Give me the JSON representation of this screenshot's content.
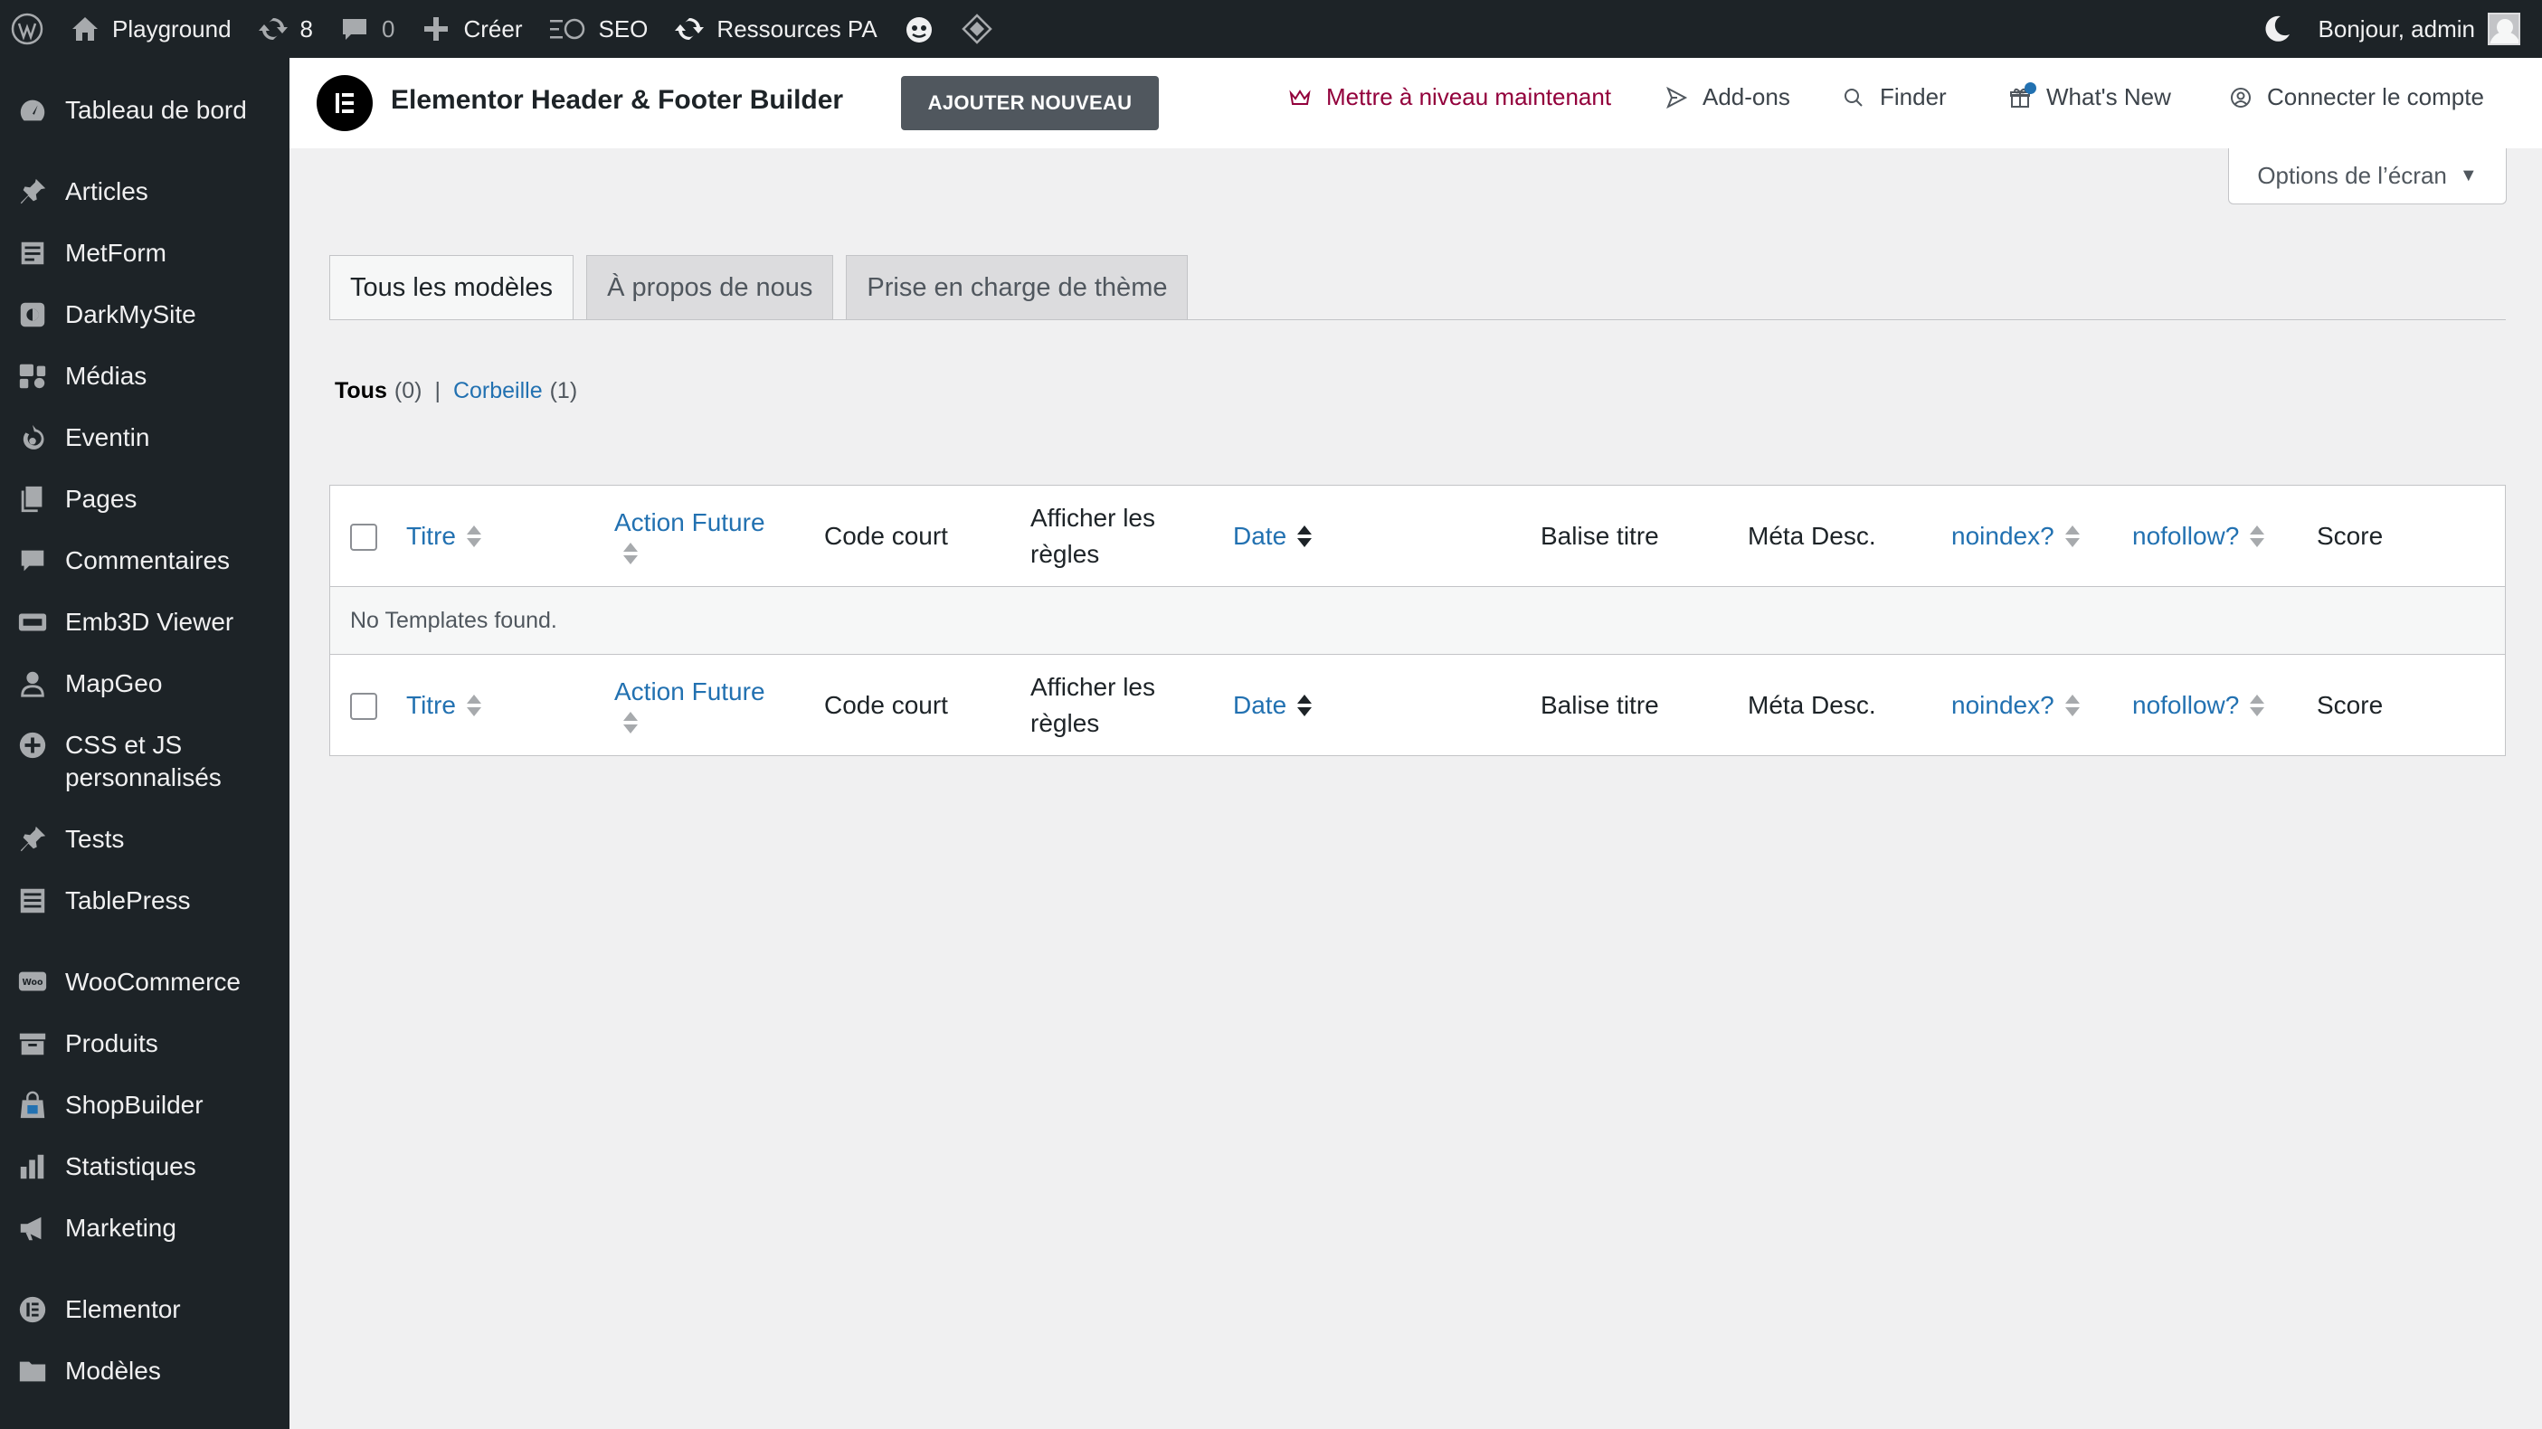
{
  "adminbar": {
    "site_name": "Playground",
    "updates_count": "8",
    "comments_count": "0",
    "new_label": "Créer",
    "seo_label": "SEO",
    "resources_label": "Ressources PA",
    "greeting": "Bonjour, admin"
  },
  "sidebar": {
    "items": [
      {
        "label": "Tableau de bord",
        "icon": "dashboard-icon"
      },
      {
        "label": "Articles",
        "icon": "pin-icon"
      },
      {
        "label": "MetForm",
        "icon": "form-icon"
      },
      {
        "label": "DarkMySite",
        "icon": "brightness-icon"
      },
      {
        "label": "Médias",
        "icon": "media-icon"
      },
      {
        "label": "Eventin",
        "icon": "eventin-icon"
      },
      {
        "label": "Pages",
        "icon": "pages-icon"
      },
      {
        "label": "Commentaires",
        "icon": "comment-icon"
      },
      {
        "label": "Emb3D Viewer",
        "icon": "emb3d-icon"
      },
      {
        "label": "MapGeo",
        "icon": "location-icon"
      },
      {
        "label": "CSS et JS personnalisés",
        "icon": "plus-circle-icon"
      },
      {
        "label": "Tests",
        "icon": "pin-icon"
      },
      {
        "label": "TablePress",
        "icon": "table-icon"
      },
      {
        "label": "WooCommerce",
        "icon": "woo-icon"
      },
      {
        "label": "Produits",
        "icon": "archive-icon"
      },
      {
        "label": "ShopBuilder",
        "icon": "bag-icon"
      },
      {
        "label": "Statistiques",
        "icon": "chart-bar-icon"
      },
      {
        "label": "Marketing",
        "icon": "megaphone-icon"
      },
      {
        "label": "Elementor",
        "icon": "elementor-icon"
      },
      {
        "label": "Modèles",
        "icon": "folder-icon"
      }
    ]
  },
  "header": {
    "plugin_title": "Elementor Header & Footer Builder",
    "add_new": "AJOUTER NOUVEAU",
    "upgrade": "Mettre à niveau maintenant",
    "addons": "Add-ons",
    "finder": "Finder",
    "whats_new": "What's New",
    "connect": "Connecter le compte"
  },
  "screen_options": "Options de l’écran",
  "tabs": [
    {
      "label": "Tous les modèles",
      "active": true
    },
    {
      "label": "À propos de nous",
      "active": false
    },
    {
      "label": "Prise en charge de thème",
      "active": false
    }
  ],
  "views": {
    "all_label": "Tous",
    "all_count": "(0)",
    "separator": "|",
    "trash_label": "Corbeille",
    "trash_count": "(1)"
  },
  "table": {
    "columns": {
      "title": "Titre",
      "action_future": "Action Future",
      "shortcode": "Code court",
      "display_rules_1": "Afficher les",
      "display_rules_2": "règles",
      "date": "Date",
      "seo_title": "Balise titre",
      "meta_desc": "Méta Desc.",
      "noindex": "noindex?",
      "nofollow": "nofollow?",
      "score": "Score"
    },
    "empty_message": "No Templates found."
  },
  "colors": {
    "admin_dark": "#1d2327",
    "link": "#2271b1",
    "upgrade": "#92003b",
    "button": "#50575e"
  }
}
